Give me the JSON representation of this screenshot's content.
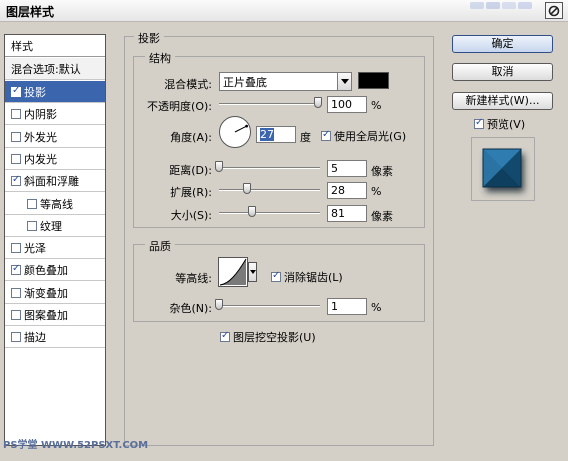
{
  "window": {
    "title": "图层样式"
  },
  "sidebar": {
    "header": "样式",
    "blend_item": "混合选项:默认",
    "items": [
      {
        "label": "投影",
        "checked": true,
        "selected": true,
        "sub": false
      },
      {
        "label": "内阴影",
        "checked": false,
        "selected": false,
        "sub": false
      },
      {
        "label": "外发光",
        "checked": false,
        "selected": false,
        "sub": false
      },
      {
        "label": "内发光",
        "checked": false,
        "selected": false,
        "sub": false
      },
      {
        "label": "斜面和浮雕",
        "checked": true,
        "selected": false,
        "sub": false
      },
      {
        "label": "等高线",
        "checked": false,
        "selected": false,
        "sub": true
      },
      {
        "label": "纹理",
        "checked": false,
        "selected": false,
        "sub": true
      },
      {
        "label": "光泽",
        "checked": false,
        "selected": false,
        "sub": false
      },
      {
        "label": "颜色叠加",
        "checked": true,
        "selected": false,
        "sub": false
      },
      {
        "label": "渐变叠加",
        "checked": false,
        "selected": false,
        "sub": false
      },
      {
        "label": "图案叠加",
        "checked": false,
        "selected": false,
        "sub": false
      },
      {
        "label": "描边",
        "checked": false,
        "selected": false,
        "sub": false
      }
    ]
  },
  "panel": {
    "title": "投影",
    "structure": {
      "title": "结构",
      "blend_mode_label": "混合模式:",
      "blend_mode_value": "正片叠底",
      "shadow_color": "#000000",
      "opacity_label": "不透明度(O):",
      "opacity_value": "100",
      "opacity_unit": "%",
      "opacity_level": 1.0,
      "angle_label": "角度(A):",
      "angle_value": "27",
      "angle_unit": "度",
      "global_light_label": "使用全局光(G)",
      "global_light_checked": true,
      "distance_label": "距离(D):",
      "distance_value": "5",
      "distance_unit": "像素",
      "distance_level": 0.0,
      "spread_label": "扩展(R):",
      "spread_value": "28",
      "spread_unit": "%",
      "spread_level": 0.28,
      "size_label": "大小(S):",
      "size_value": "81",
      "size_unit": "像素",
      "size_level": 0.33
    },
    "quality": {
      "title": "品质",
      "contour_label": "等高线:",
      "antialias_label": "消除锯齿(L)",
      "antialias_checked": true,
      "noise_label": "杂色(N):",
      "noise_value": "1",
      "noise_unit": "%",
      "noise_level": 0.0
    },
    "knockout_label": "图层挖空投影(U)",
    "knockout_checked": true
  },
  "actions": {
    "ok": "确定",
    "cancel": "取消",
    "new_style": "新建样式(W)...",
    "preview_label": "预览(V)",
    "preview_checked": true
  },
  "watermark": "PS学堂 WWW.52PSXT.COM",
  "colors": {
    "selection": "#3b66ae",
    "preview_tile": "#1c5f8a"
  }
}
